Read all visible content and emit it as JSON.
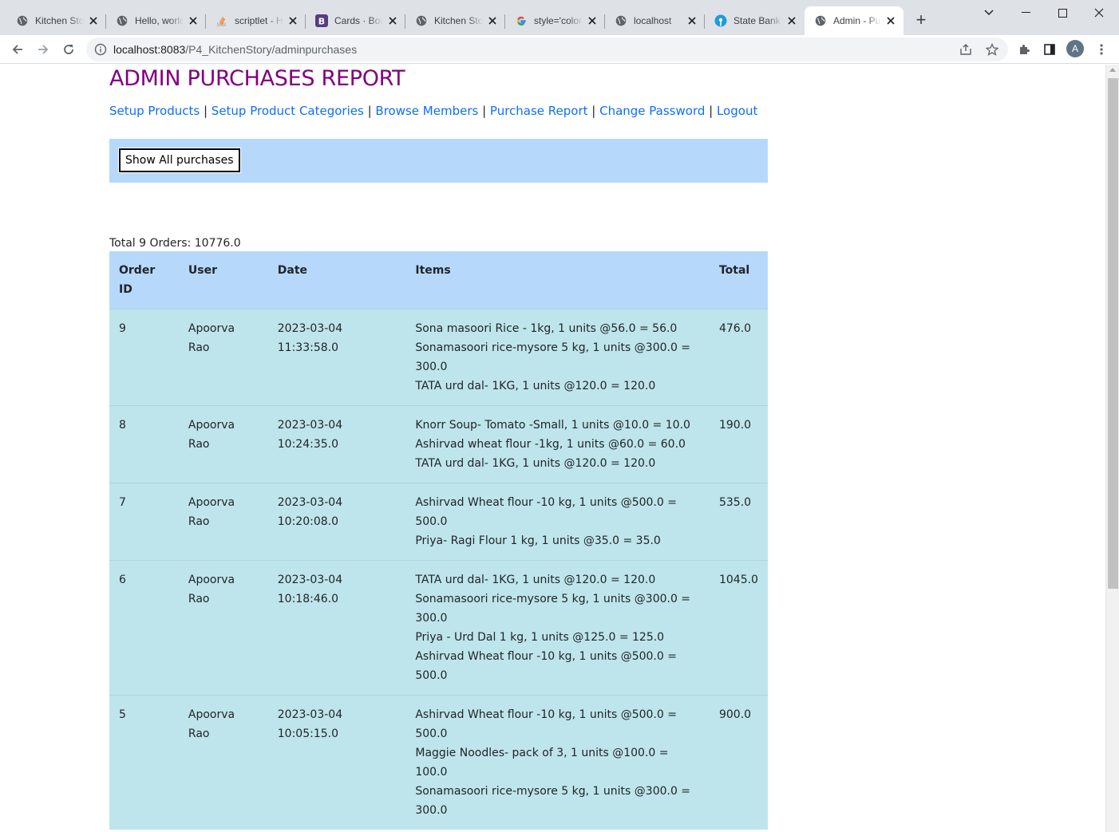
{
  "browser": {
    "tabs": [
      {
        "title": "Kitchen Story",
        "icon": "globe-icon",
        "active": false
      },
      {
        "title": "Hello, world!",
        "icon": "globe-icon",
        "active": false
      },
      {
        "title": "scriptlet - How",
        "icon": "stackoverflow-icon",
        "active": false
      },
      {
        "title": "Cards · Bootstrap",
        "icon": "bootstrap-icon",
        "active": false
      },
      {
        "title": "Kitchen Story",
        "icon": "globe-icon",
        "active": false
      },
      {
        "title": "style='color",
        "icon": "google-icon",
        "active": false
      },
      {
        "title": "localhost",
        "icon": "globe-icon",
        "active": false
      },
      {
        "title": "State Bank",
        "icon": "sbi-icon",
        "active": false
      },
      {
        "title": "Admin - Purchases",
        "icon": "globe-icon",
        "active": true
      }
    ],
    "address": {
      "host": "localhost:8083",
      "path": "/P4_KitchenStory/adminpurchases"
    },
    "profile_initial": "A"
  },
  "page": {
    "title": "ADMIN PURCHASES REPORT",
    "nav": [
      {
        "label": "Setup Products"
      },
      {
        "label": "Setup Product Categories"
      },
      {
        "label": "Browse Members"
      },
      {
        "label": "Purchase Report"
      },
      {
        "label": "Change Password"
      },
      {
        "label": "Logout"
      }
    ],
    "nav_separator": " | ",
    "filter": {
      "show_all_label": "Show All purchases"
    },
    "total_line": "Total 9 Orders: 10776.0",
    "table": {
      "headers": {
        "order_id": "Order ID",
        "user": "User",
        "date": "Date",
        "items": "Items",
        "total": "Total"
      },
      "rows": [
        {
          "order_id": "9",
          "user": "Apoorva Rao",
          "date": "2023-03-04 11:33:58.0",
          "items": [
            "Sona masoori Rice - 1kg, 1 units @56.0 = 56.0",
            "Sonamasoori rice-mysore 5 kg, 1 units @300.0 = 300.0",
            "TATA urd dal- 1KG, 1 units @120.0 = 120.0"
          ],
          "total": "476.0"
        },
        {
          "order_id": "8",
          "user": "Apoorva Rao",
          "date": "2023-03-04 10:24:35.0",
          "items": [
            "Knorr Soup- Tomato -Small, 1 units @10.0 = 10.0",
            "Ashirvad wheat flour -1kg, 1 units @60.0 = 60.0",
            "TATA urd dal- 1KG, 1 units @120.0 = 120.0"
          ],
          "total": "190.0"
        },
        {
          "order_id": "7",
          "user": "Apoorva Rao",
          "date": "2023-03-04 10:20:08.0",
          "items": [
            "Ashirvad Wheat flour -10 kg, 1 units @500.0 = 500.0",
            "Priya- Ragi Flour 1 kg, 1 units @35.0 = 35.0"
          ],
          "total": "535.0"
        },
        {
          "order_id": "6",
          "user": "Apoorva Rao",
          "date": "2023-03-04 10:18:46.0",
          "items": [
            "TATA urd dal- 1KG, 1 units @120.0 = 120.0",
            "Sonamasoori rice-mysore 5 kg, 1 units @300.0 = 300.0",
            "Priya - Urd Dal 1 kg, 1 units @125.0 = 125.0",
            "Ashirvad Wheat flour -10 kg, 1 units @500.0 = 500.0"
          ],
          "total": "1045.0"
        },
        {
          "order_id": "5",
          "user": "Apoorva Rao",
          "date": "2023-03-04 10:05:15.0",
          "items": [
            "Ashirvad Wheat flour -10 kg, 1 units @500.0 = 500.0",
            "Maggie Noodles- pack of 3, 1 units @100.0 = 100.0",
            "Sonamasoori rice-mysore 5 kg, 1 units @300.0 = 300.0"
          ],
          "total": "900.0"
        }
      ]
    }
  },
  "colors": {
    "title": "#800080",
    "link": "#0d6efd",
    "filter_bg": "#b6d8fb",
    "header_bg": "#b6d8fb",
    "row_bg": "#bee5eb"
  }
}
